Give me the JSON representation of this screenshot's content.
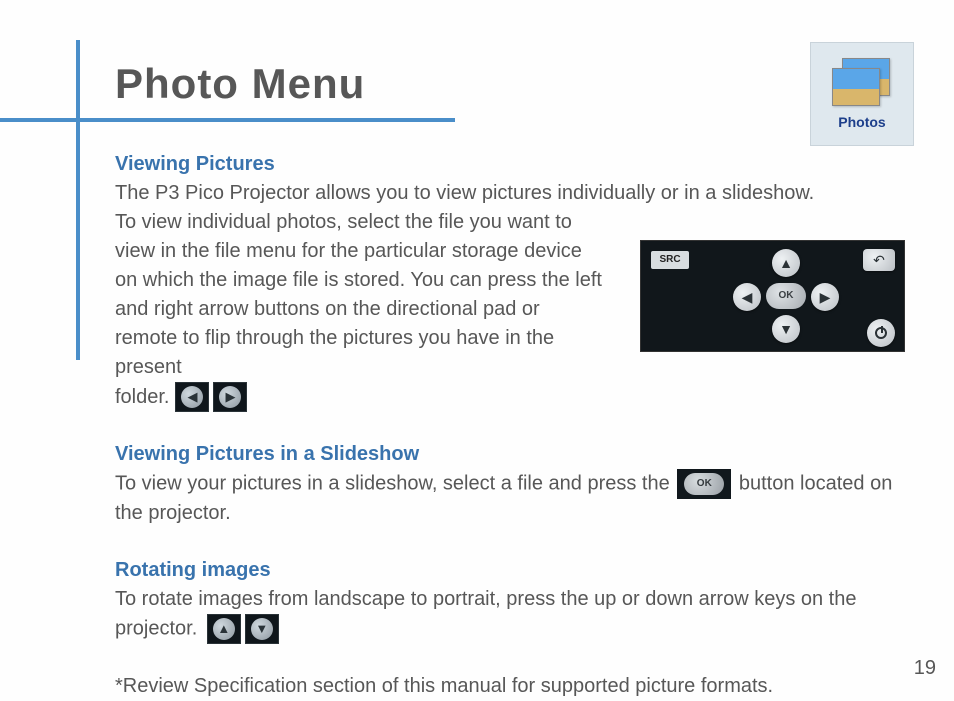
{
  "title": "Photo Menu",
  "badge": {
    "label": "Photos"
  },
  "page_number": "19",
  "dpad": {
    "src": "SRC",
    "ok": "OK"
  },
  "inline": {
    "ok": "OK"
  },
  "sections": {
    "viewing": {
      "heading": "Viewing Pictures",
      "intro": "The P3 Pico Projector allows you to view pictures individually or in a slideshow.",
      "body": "To view individual photos, select the file you want to view in the file menu for the particular storage device on which the image file is stored.  You can press the left and right arrow buttons on the directional pad or remote to flip through the pictures you have in the present",
      "tail": "folder."
    },
    "slideshow": {
      "heading": "Viewing Pictures in a Slideshow",
      "pre": "To view your pictures in a slideshow, select a file and press the",
      "post": "button located on the projector."
    },
    "rotating": {
      "heading": "Rotating images",
      "pre": "To rotate images from landscape to portrait, press the up or down arrow keys on the projector."
    },
    "footnote": "*Review Specification section of this manual for supported picture formats."
  }
}
